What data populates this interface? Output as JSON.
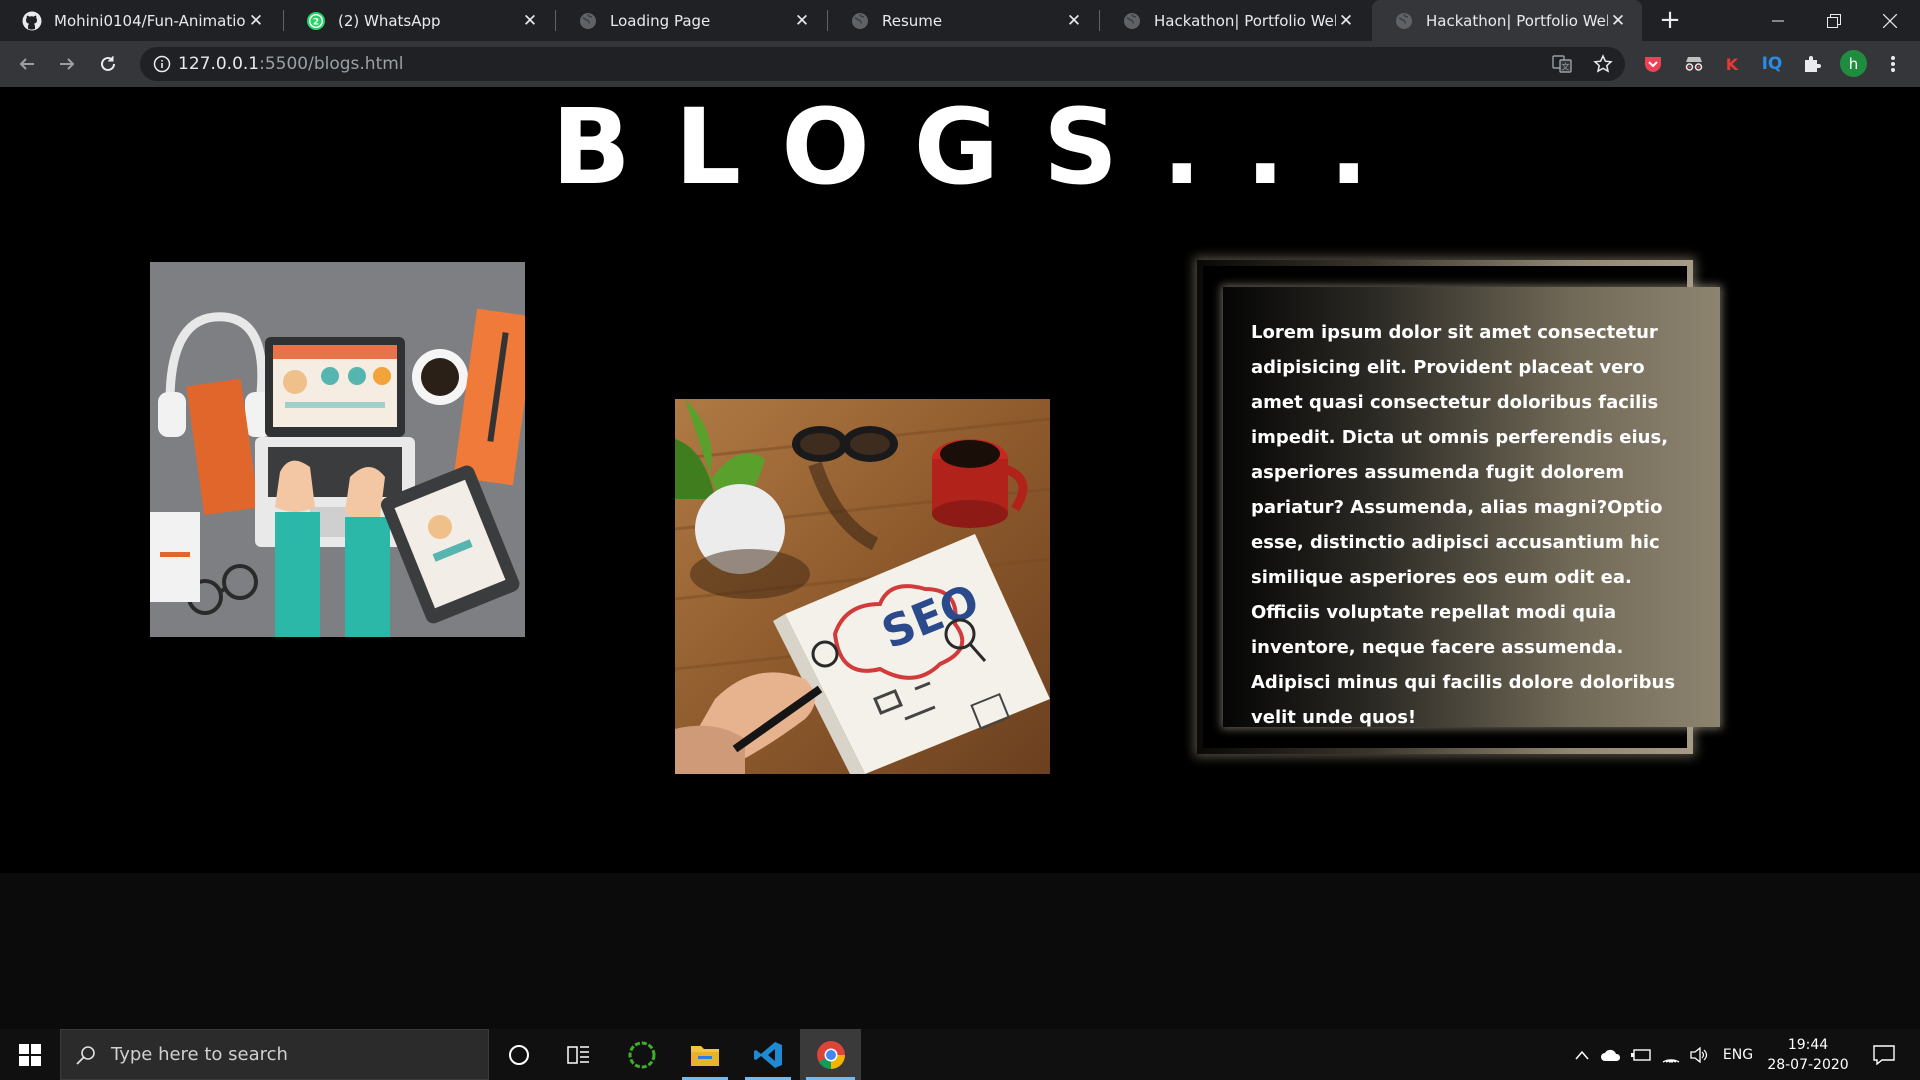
{
  "browser": {
    "tabs": [
      {
        "title": "Mohini0104/Fun-Animation-I",
        "favicon": "github-icon",
        "active": false
      },
      {
        "title": "(2) WhatsApp",
        "favicon": "whatsapp-icon",
        "active": false
      },
      {
        "title": "Loading Page",
        "favicon": "globe-icon",
        "active": false
      },
      {
        "title": "Resume",
        "favicon": "globe-icon",
        "active": false
      },
      {
        "title": "Hackathon| Portfolio Website",
        "favicon": "globe-icon",
        "active": false
      },
      {
        "title": "Hackathon| Portfolio Website",
        "favicon": "globe-icon",
        "active": true
      }
    ],
    "close_glyph": "✕",
    "new_tab_glyph": "+",
    "address": {
      "host": "127.0.0.1",
      "path": ":5500/blogs.html"
    },
    "profile_initial": "h",
    "extensions": [
      "pocket-icon",
      "incognito-ext-icon",
      "k-ext-icon",
      "iq-ext-icon",
      "puzzle-icon"
    ],
    "ext_k_label": "K",
    "ext_iq_label": "IQ"
  },
  "page": {
    "title": "BLOGS...",
    "images": [
      {
        "name": "laptop-desk-illustration"
      },
      {
        "name": "seo-notebook-photo"
      }
    ],
    "blog_text": "Lorem ipsum dolor sit amet consectetur adipisicing elit. Provident placeat vero amet quasi consectetur doloribus facilis impedit. Dicta ut omnis perferendis eius, asperiores assumenda fugit dolorem pariatur? Assumenda, alias magni?Optio esse, distinctio adipisci accusantium hic similique asperiores eos eum odit ea. Officiis voluptate repellat modi quia inventore, neque facere assumenda. Adipisci minus qui facilis dolore doloribus velit unde quos!",
    "seo_label": "SEO"
  },
  "taskbar": {
    "search_placeholder": "Type here to search",
    "language": "ENG",
    "time": "19:44",
    "date": "28-07-2020"
  },
  "colors": {
    "tabstrip": "#202124",
    "toolbar": "#35363a",
    "page_bg": "#000000",
    "frame_gold": "#a59b87"
  }
}
